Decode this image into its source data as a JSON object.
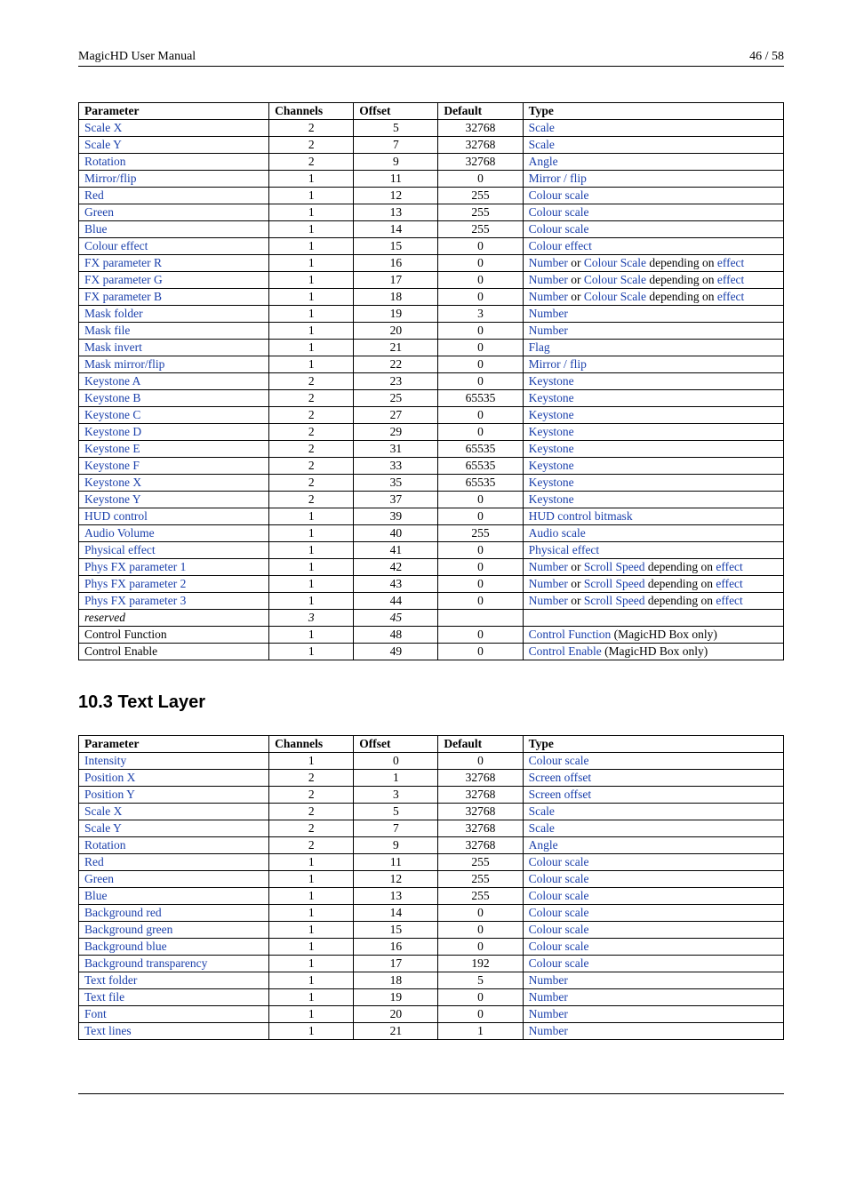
{
  "header": {
    "left": "MagicHD User Manual",
    "right": "46 / 58"
  },
  "columns": {
    "p": "Parameter",
    "c": "Channels",
    "o": "Offset",
    "d": "Default",
    "t": "Type"
  },
  "table1": [
    {
      "p": "Scale X",
      "pl": true,
      "c": "2",
      "o": "5",
      "d": "32768",
      "type": [
        {
          "t": "Scale",
          "l": true
        }
      ]
    },
    {
      "p": "Scale Y",
      "pl": true,
      "c": "2",
      "o": "7",
      "d": "32768",
      "type": [
        {
          "t": "Scale",
          "l": true
        }
      ]
    },
    {
      "p": "Rotation",
      "pl": true,
      "c": "2",
      "o": "9",
      "d": "32768",
      "type": [
        {
          "t": "Angle",
          "l": true
        }
      ]
    },
    {
      "p": "Mirror/flip",
      "pl": true,
      "c": "1",
      "o": "11",
      "d": "0",
      "type": [
        {
          "t": "Mirror / flip",
          "l": true
        }
      ]
    },
    {
      "p": "Red",
      "pl": true,
      "c": "1",
      "o": "12",
      "d": "255",
      "type": [
        {
          "t": "Colour scale",
          "l": true
        }
      ]
    },
    {
      "p": "Green",
      "pl": true,
      "c": "1",
      "o": "13",
      "d": "255",
      "type": [
        {
          "t": "Colour scale",
          "l": true
        }
      ]
    },
    {
      "p": "Blue",
      "pl": true,
      "c": "1",
      "o": "14",
      "d": "255",
      "type": [
        {
          "t": "Colour scale",
          "l": true
        }
      ]
    },
    {
      "p": "Colour effect",
      "pl": true,
      "c": "1",
      "o": "15",
      "d": "0",
      "type": [
        {
          "t": "Colour effect",
          "l": true
        }
      ]
    },
    {
      "p": "FX parameter R",
      "pl": true,
      "c": "1",
      "o": "16",
      "d": "0",
      "type": [
        {
          "t": "Number",
          "l": true
        },
        {
          "t": " or "
        },
        {
          "t": "Colour Scale",
          "l": true
        },
        {
          "t": " depending on "
        },
        {
          "t": "effect",
          "l": true
        }
      ]
    },
    {
      "p": "FX parameter G",
      "pl": true,
      "c": "1",
      "o": "17",
      "d": "0",
      "type": [
        {
          "t": "Number",
          "l": true
        },
        {
          "t": " or "
        },
        {
          "t": "Colour Scale",
          "l": true
        },
        {
          "t": " depending on "
        },
        {
          "t": "effect",
          "l": true
        }
      ]
    },
    {
      "p": "FX parameter B",
      "pl": true,
      "c": "1",
      "o": "18",
      "d": "0",
      "type": [
        {
          "t": "Number",
          "l": true
        },
        {
          "t": " or "
        },
        {
          "t": "Colour Scale",
          "l": true
        },
        {
          "t": " depending on "
        },
        {
          "t": "effect",
          "l": true
        }
      ]
    },
    {
      "p": "Mask folder",
      "pl": true,
      "c": "1",
      "o": "19",
      "d": "3",
      "type": [
        {
          "t": "Number",
          "l": true
        }
      ]
    },
    {
      "p": "Mask file",
      "pl": true,
      "c": "1",
      "o": "20",
      "d": "0",
      "type": [
        {
          "t": "Number",
          "l": true
        }
      ]
    },
    {
      "p": "Mask invert",
      "pl": true,
      "c": "1",
      "o": "21",
      "d": "0",
      "type": [
        {
          "t": "Flag",
          "l": true
        }
      ]
    },
    {
      "p": "Mask mirror/flip",
      "pl": true,
      "c": "1",
      "o": "22",
      "d": "0",
      "type": [
        {
          "t": "Mirror / flip",
          "l": true
        }
      ]
    },
    {
      "p": "Keystone A",
      "pl": true,
      "c": "2",
      "o": "23",
      "d": "0",
      "type": [
        {
          "t": "Keystone",
          "l": true
        }
      ]
    },
    {
      "p": "Keystone B",
      "pl": true,
      "c": "2",
      "o": "25",
      "d": "65535",
      "type": [
        {
          "t": "Keystone",
          "l": true
        }
      ]
    },
    {
      "p": "Keystone C",
      "pl": true,
      "c": "2",
      "o": "27",
      "d": "0",
      "type": [
        {
          "t": "Keystone",
          "l": true
        }
      ]
    },
    {
      "p": "Keystone D",
      "pl": true,
      "c": "2",
      "o": "29",
      "d": "0",
      "type": [
        {
          "t": "Keystone",
          "l": true
        }
      ]
    },
    {
      "p": "Keystone E",
      "pl": true,
      "c": "2",
      "o": "31",
      "d": "65535",
      "type": [
        {
          "t": "Keystone",
          "l": true
        }
      ]
    },
    {
      "p": "Keystone F",
      "pl": true,
      "c": "2",
      "o": "33",
      "d": "65535",
      "type": [
        {
          "t": "Keystone",
          "l": true
        }
      ]
    },
    {
      "p": "Keystone X",
      "pl": true,
      "c": "2",
      "o": "35",
      "d": "65535",
      "type": [
        {
          "t": "Keystone",
          "l": true
        }
      ]
    },
    {
      "p": "Keystone Y",
      "pl": true,
      "c": "2",
      "o": "37",
      "d": "0",
      "type": [
        {
          "t": "Keystone",
          "l": true
        }
      ]
    },
    {
      "p": "HUD control",
      "pl": true,
      "c": "1",
      "o": "39",
      "d": "0",
      "type": [
        {
          "t": "HUD control bitmask",
          "l": true
        }
      ]
    },
    {
      "p": "Audio Volume",
      "pl": true,
      "c": "1",
      "o": "40",
      "d": "255",
      "type": [
        {
          "t": "Audio scale",
          "l": true
        }
      ]
    },
    {
      "p": "Physical effect",
      "pl": true,
      "c": "1",
      "o": "41",
      "d": "0",
      "type": [
        {
          "t": "Physical effect",
          "l": true
        }
      ]
    },
    {
      "p": "Phys FX parameter 1",
      "pl": true,
      "c": "1",
      "o": "42",
      "d": "0",
      "type": [
        {
          "t": "Number",
          "l": true
        },
        {
          "t": " or "
        },
        {
          "t": "Scroll Speed",
          "l": true
        },
        {
          "t": " depending on "
        },
        {
          "t": "effect",
          "l": true
        }
      ]
    },
    {
      "p": "Phys FX parameter 2",
      "pl": true,
      "c": "1",
      "o": "43",
      "d": "0",
      "type": [
        {
          "t": "Number",
          "l": true
        },
        {
          "t": " or "
        },
        {
          "t": "Scroll Speed",
          "l": true
        },
        {
          "t": " depending on "
        },
        {
          "t": "effect",
          "l": true
        }
      ]
    },
    {
      "p": "Phys FX parameter 3",
      "pl": true,
      "c": "1",
      "o": "44",
      "d": "0",
      "type": [
        {
          "t": "Number",
          "l": true
        },
        {
          "t": " or "
        },
        {
          "t": "Scroll Speed",
          "l": true
        },
        {
          "t": " depending on "
        },
        {
          "t": "effect",
          "l": true
        }
      ]
    },
    {
      "p": "reserved",
      "pl": false,
      "pi": true,
      "c": "3",
      "ci": true,
      "o": "45",
      "oi": true,
      "d": "",
      "type": []
    },
    {
      "p": "Control Function",
      "pl": false,
      "c": "1",
      "o": "48",
      "d": "0",
      "type": [
        {
          "t": "Control Function",
          "l": true
        },
        {
          "t": " (MagicHD Box only)"
        }
      ]
    },
    {
      "p": "Control Enable",
      "pl": false,
      "c": "1",
      "o": "49",
      "d": "0",
      "type": [
        {
          "t": "Control Enable",
          "l": true
        },
        {
          "t": " (MagicHD Box only)"
        }
      ]
    }
  ],
  "section": "10.3   Text Layer",
  "table2": [
    {
      "p": "Intensity",
      "pl": true,
      "c": "1",
      "o": "0",
      "d": "0",
      "type": [
        {
          "t": "Colour scale",
          "l": true
        }
      ]
    },
    {
      "p": "Position X",
      "pl": true,
      "c": "2",
      "o": "1",
      "d": "32768",
      "type": [
        {
          "t": "Screen offset",
          "l": true
        }
      ]
    },
    {
      "p": "Position Y",
      "pl": true,
      "c": "2",
      "o": "3",
      "d": "32768",
      "type": [
        {
          "t": "Screen offset",
          "l": true
        }
      ]
    },
    {
      "p": "Scale X",
      "pl": true,
      "c": "2",
      "o": "5",
      "d": "32768",
      "type": [
        {
          "t": "Scale",
          "l": true
        }
      ]
    },
    {
      "p": "Scale Y",
      "pl": true,
      "c": "2",
      "o": "7",
      "d": "32768",
      "type": [
        {
          "t": "Scale",
          "l": true
        }
      ]
    },
    {
      "p": "Rotation",
      "pl": true,
      "c": "2",
      "o": "9",
      "d": "32768",
      "type": [
        {
          "t": "Angle",
          "l": true
        }
      ]
    },
    {
      "p": "Red",
      "pl": true,
      "c": "1",
      "o": "11",
      "d": "255",
      "type": [
        {
          "t": "Colour scale",
          "l": true
        }
      ]
    },
    {
      "p": "Green",
      "pl": true,
      "c": "1",
      "o": "12",
      "d": "255",
      "type": [
        {
          "t": "Colour scale",
          "l": true
        }
      ]
    },
    {
      "p": "Blue",
      "pl": true,
      "c": "1",
      "o": "13",
      "d": "255",
      "type": [
        {
          "t": "Colour scale",
          "l": true
        }
      ]
    },
    {
      "p": "Background red",
      "pl": true,
      "c": "1",
      "o": "14",
      "d": "0",
      "type": [
        {
          "t": "Colour scale",
          "l": true
        }
      ]
    },
    {
      "p": "Background green",
      "pl": true,
      "c": "1",
      "o": "15",
      "d": "0",
      "type": [
        {
          "t": "Colour scale",
          "l": true
        }
      ]
    },
    {
      "p": "Background blue",
      "pl": true,
      "c": "1",
      "o": "16",
      "d": "0",
      "type": [
        {
          "t": "Colour scale",
          "l": true
        }
      ]
    },
    {
      "p": "Background transparency",
      "pl": true,
      "c": "1",
      "o": "17",
      "d": "192",
      "type": [
        {
          "t": "Colour scale",
          "l": true
        }
      ]
    },
    {
      "p": "Text folder",
      "pl": true,
      "c": "1",
      "o": "18",
      "d": "5",
      "type": [
        {
          "t": "Number",
          "l": true
        }
      ]
    },
    {
      "p": "Text file",
      "pl": true,
      "c": "1",
      "o": "19",
      "d": "0",
      "type": [
        {
          "t": "Number",
          "l": true
        }
      ]
    },
    {
      "p": "Font",
      "pl": true,
      "c": "1",
      "o": "20",
      "d": "0",
      "type": [
        {
          "t": "Number",
          "l": true
        }
      ]
    },
    {
      "p": "Text lines",
      "pl": true,
      "c": "1",
      "o": "21",
      "d": "1",
      "type": [
        {
          "t": "Number",
          "l": true
        }
      ]
    }
  ]
}
